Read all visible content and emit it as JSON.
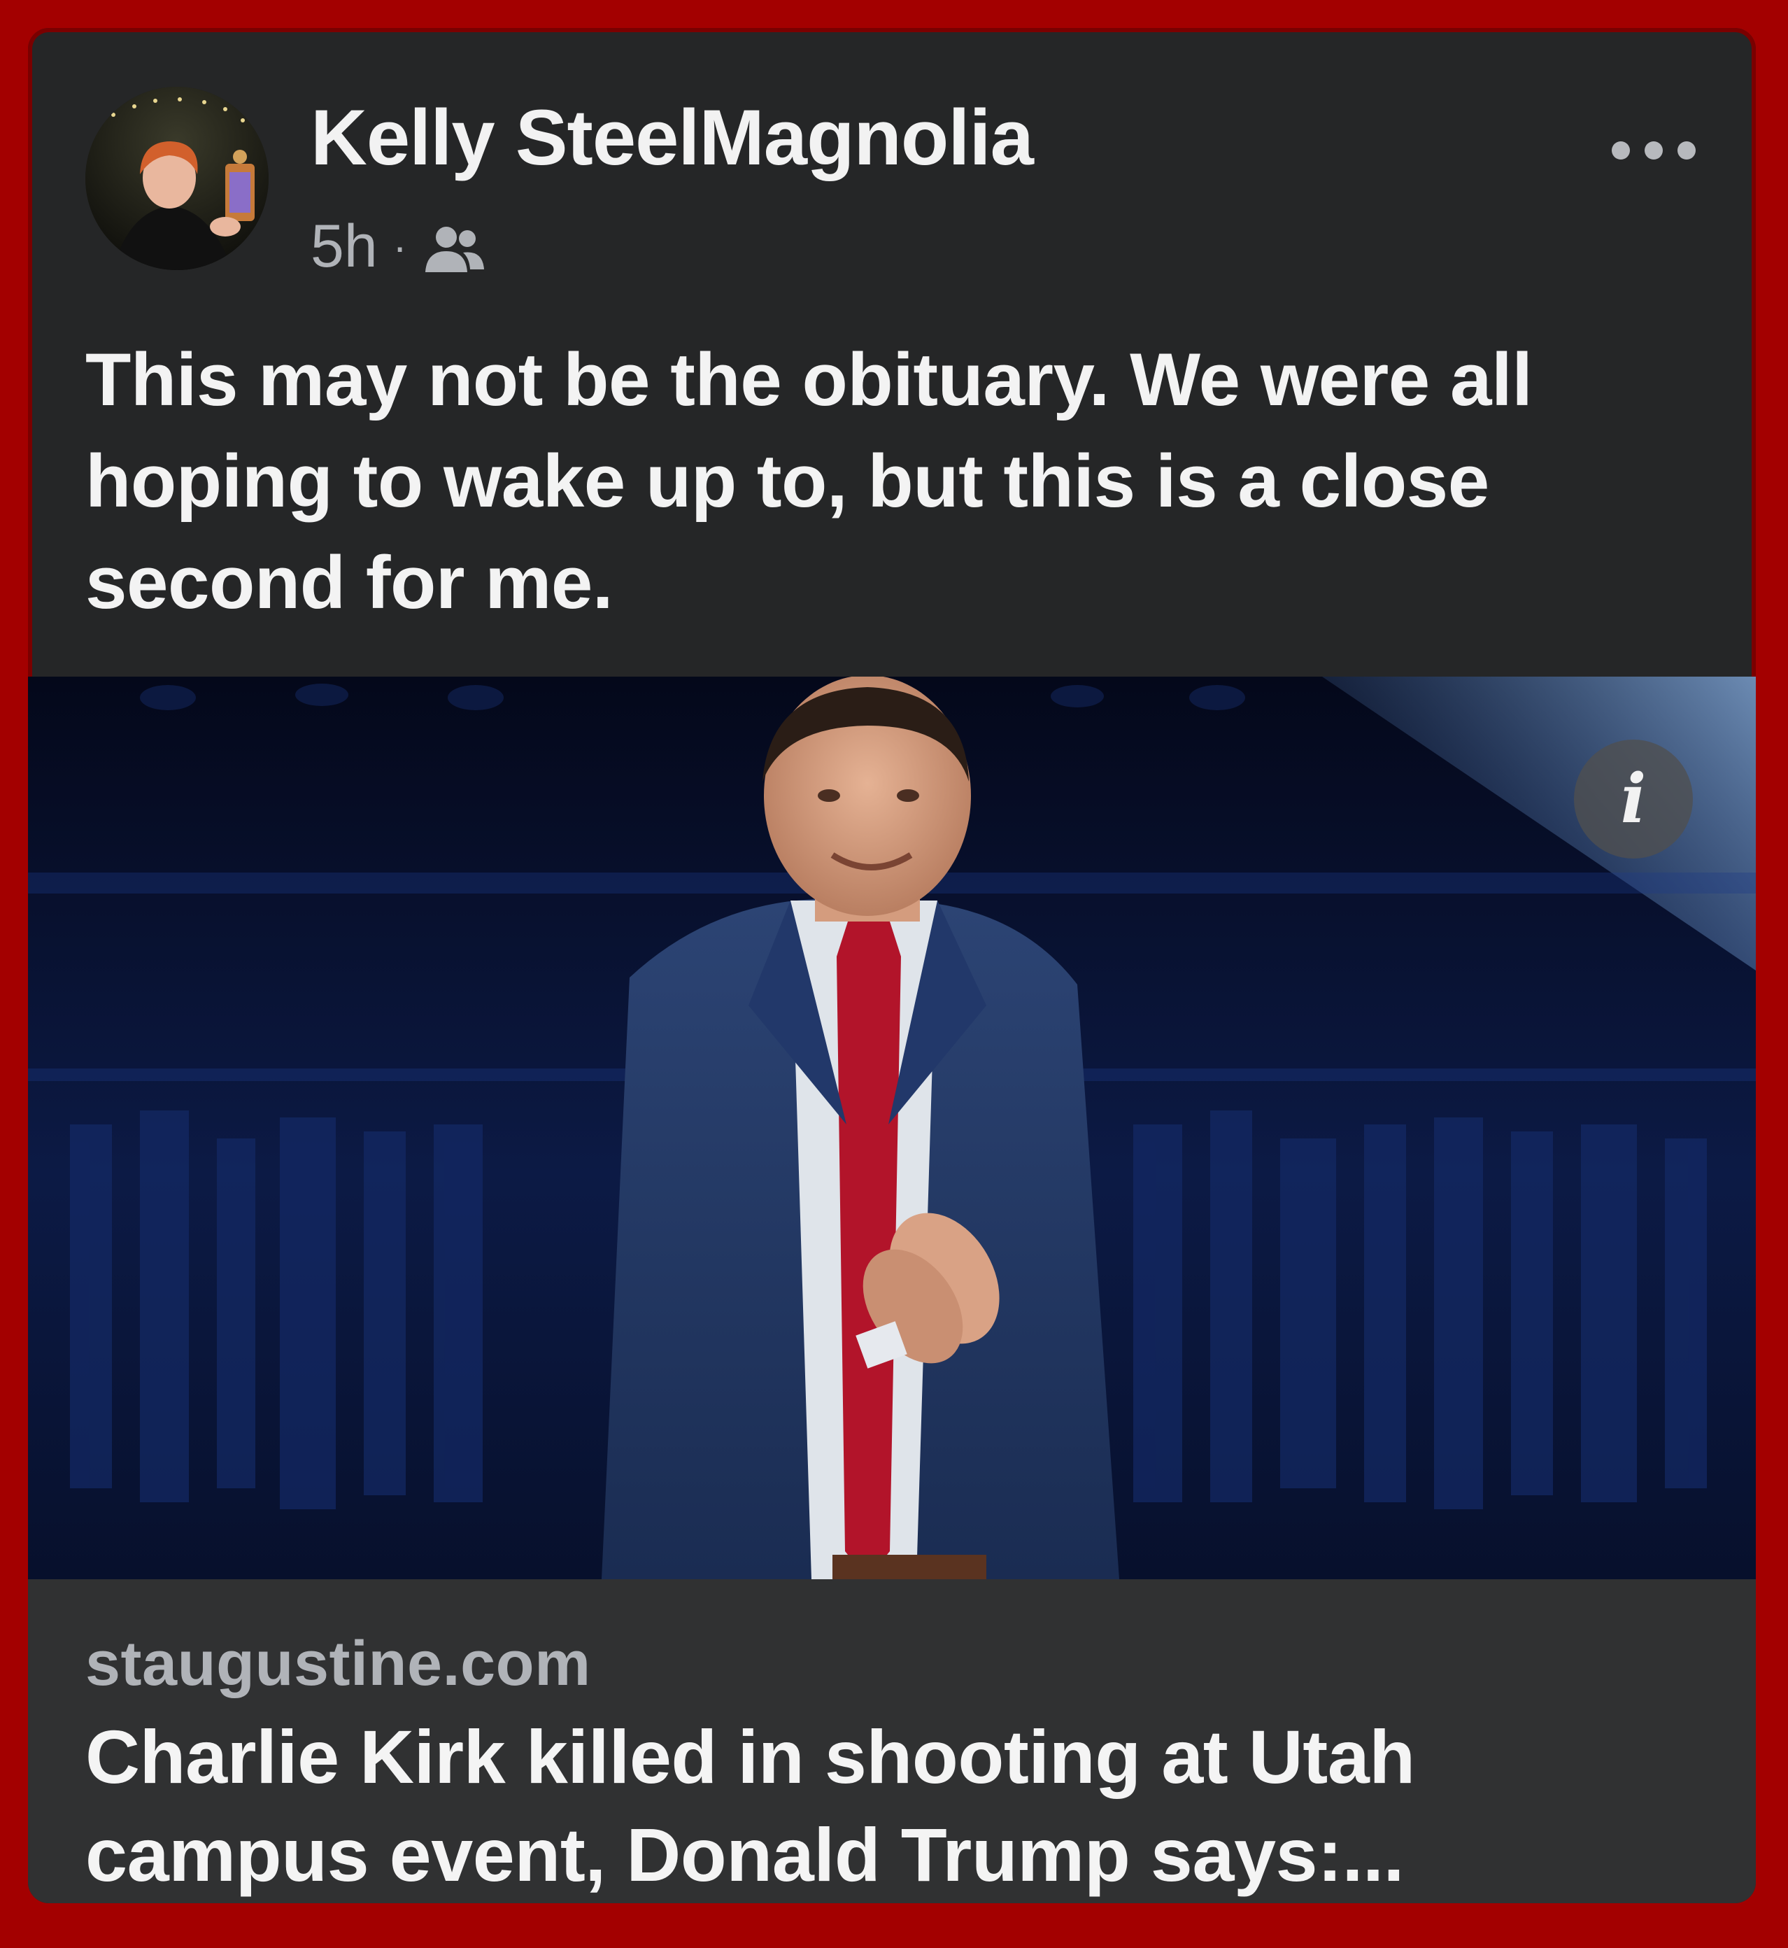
{
  "post": {
    "author_name": "Kelly SteelMagnolia",
    "timestamp": "5h",
    "separator": "·",
    "audience_icon": "friends-icon",
    "more_icon": "more-options-icon",
    "text": "This may not be the obituary. We were all hoping to wake up to, but this is a close second for me."
  },
  "link_preview": {
    "info_glyph": "i",
    "domain": "staugustine.com",
    "title": "Charlie Kirk killed in shooting at Utah campus event, Donald Trump says:..."
  },
  "colors": {
    "frame": "#a30000",
    "card_background": "#252627",
    "link_footer_background": "#303132",
    "primary_text": "#f3f3f3",
    "secondary_text": "#b0b3b8"
  }
}
